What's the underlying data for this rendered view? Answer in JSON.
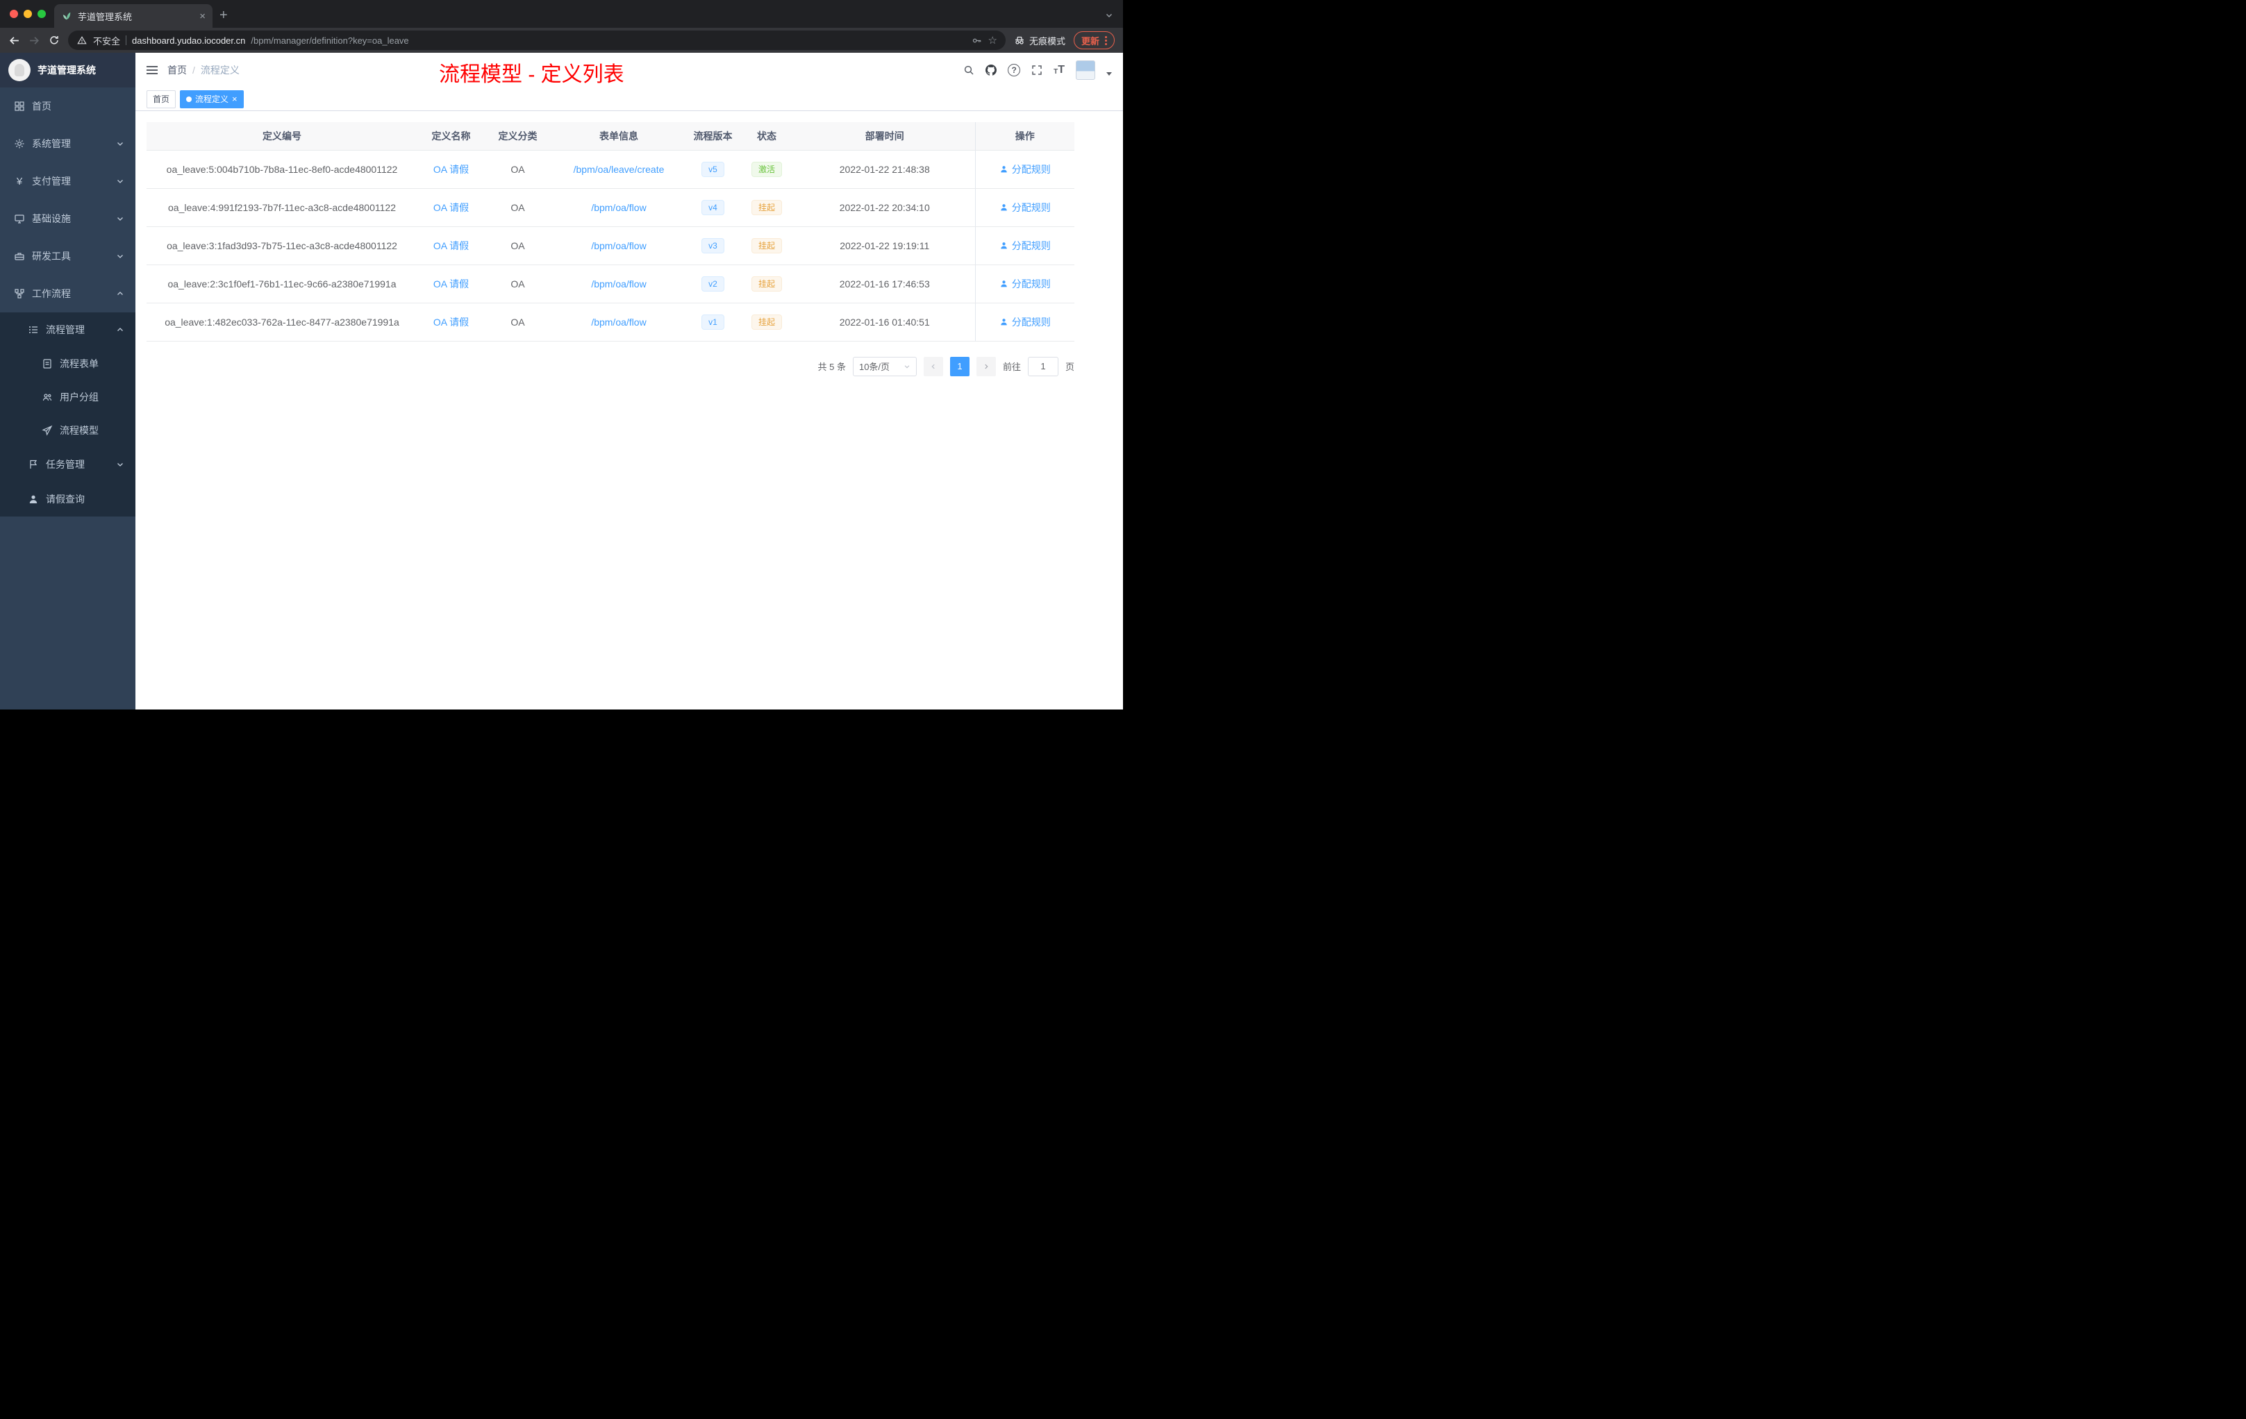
{
  "colors": {
    "accent": "#409eff",
    "annotation_red": "#ff0000",
    "status_success": "#67c23a",
    "status_warning": "#e6a23c",
    "sidebar_bg": "#304156",
    "chrome_dark": "#202124"
  },
  "icons": {
    "close": "×",
    "new_tab": "+",
    "star": "☆",
    "question": "?",
    "breadcrumb_sep": "/"
  },
  "browser": {
    "tab_title": "芋道管理系统",
    "security": "不安全",
    "url_host": "dashboard.yudao.iocoder.cn",
    "url_path": "/bpm/manager/definition?key=oa_leave",
    "incognito": "无痕模式",
    "update": "更新"
  },
  "sidebar": {
    "brand": "芋道管理系统",
    "items": [
      {
        "label": "首页"
      },
      {
        "label": "系统管理"
      },
      {
        "label": "支付管理"
      },
      {
        "label": "基础设施"
      },
      {
        "label": "研发工具"
      },
      {
        "label": "工作流程"
      },
      {
        "label": "流程管理"
      },
      {
        "label": "流程表单"
      },
      {
        "label": "用户分组"
      },
      {
        "label": "流程模型"
      },
      {
        "label": "任务管理"
      },
      {
        "label": "请假查询"
      }
    ]
  },
  "header": {
    "breadcrumb": [
      "首页",
      "流程定义"
    ],
    "annotation": "流程模型 - 定义列表"
  },
  "tags": {
    "home": "首页",
    "active": "流程定义"
  },
  "table": {
    "columns": [
      "定义编号",
      "定义名称",
      "定义分类",
      "表单信息",
      "流程版本",
      "状态",
      "部署时间",
      "操作"
    ],
    "rows": [
      {
        "id": "oa_leave:5:004b710b-7b8a-11ec-8ef0-acde48001122",
        "name": "OA 请假",
        "category": "OA",
        "form": "/bpm/oa/leave/create",
        "version": "v5",
        "status": "激活",
        "time": "2022-01-22 21:48:38",
        "action": "分配规则"
      },
      {
        "id": "oa_leave:4:991f2193-7b7f-11ec-a3c8-acde48001122",
        "name": "OA 请假",
        "category": "OA",
        "form": "/bpm/oa/flow",
        "version": "v4",
        "status": "挂起",
        "time": "2022-01-22 20:34:10",
        "action": "分配规则"
      },
      {
        "id": "oa_leave:3:1fad3d93-7b75-11ec-a3c8-acde48001122",
        "name": "OA 请假",
        "category": "OA",
        "form": "/bpm/oa/flow",
        "version": "v3",
        "status": "挂起",
        "time": "2022-01-22 19:19:11",
        "action": "分配规则"
      },
      {
        "id": "oa_leave:2:3c1f0ef1-76b1-11ec-9c66-a2380e71991a",
        "name": "OA 请假",
        "category": "OA",
        "form": "/bpm/oa/flow",
        "version": "v2",
        "status": "挂起",
        "time": "2022-01-16 17:46:53",
        "action": "分配规则"
      },
      {
        "id": "oa_leave:1:482ec033-762a-11ec-8477-a2380e71991a",
        "name": "OA 请假",
        "category": "OA",
        "form": "/bpm/oa/flow",
        "version": "v1",
        "status": "挂起",
        "time": "2022-01-16 01:40:51",
        "action": "分配规则"
      }
    ]
  },
  "pagination": {
    "total": "共 5 条",
    "page_size": "10条/页",
    "current": "1",
    "goto_prefix": "前往",
    "goto_value": "1",
    "goto_suffix": "页"
  }
}
